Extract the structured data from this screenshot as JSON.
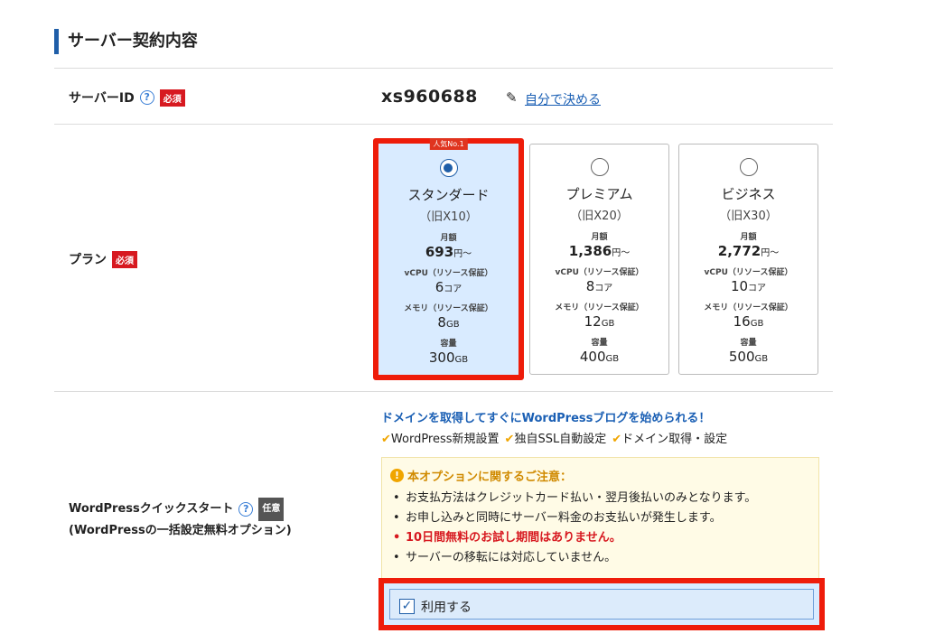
{
  "section": {
    "title": "サーバー契約内容"
  },
  "server_id_row": {
    "label": "サーバーID",
    "help": "?",
    "required": "必須",
    "value": "xs960688",
    "self_decide_link": "自分で決める"
  },
  "plan_row": {
    "label": "プラン",
    "required": "必須",
    "plans": [
      {
        "badge": "人気No.1",
        "name": "スタンダード",
        "old_name": "（旧X10）",
        "price_label": "月額",
        "price": "693",
        "price_unit": "円〜",
        "vcpu_label": "vCPU（リソース保証）",
        "vcpu": "6",
        "vcpu_unit": "コア",
        "mem_label": "メモリ（リソース保証）",
        "mem": "8",
        "mem_unit": "GB",
        "storage_label": "容量",
        "storage": "300",
        "storage_unit": "GB",
        "selected": true
      },
      {
        "name": "プレミアム",
        "old_name": "（旧X20）",
        "price_label": "月額",
        "price": "1,386",
        "price_unit": "円〜",
        "vcpu_label": "vCPU（リソース保証）",
        "vcpu": "8",
        "vcpu_unit": "コア",
        "mem_label": "メモリ（リソース保証）",
        "mem": "12",
        "mem_unit": "GB",
        "storage_label": "容量",
        "storage": "400",
        "storage_unit": "GB",
        "selected": false
      },
      {
        "name": "ビジネス",
        "old_name": "（旧X30）",
        "price_label": "月額",
        "price": "2,772",
        "price_unit": "円〜",
        "vcpu_label": "vCPU（リソース保証）",
        "vcpu": "10",
        "vcpu_unit": "コア",
        "mem_label": "メモリ（リソース保証）",
        "mem": "16",
        "mem_unit": "GB",
        "storage_label": "容量",
        "storage": "500",
        "storage_unit": "GB",
        "selected": false
      }
    ]
  },
  "wp_row": {
    "label_line1": "WordPressクイックスタート",
    "label_line2": "(WordPressの一括設定無料オプション)",
    "help": "?",
    "optional": "任意",
    "headline": "ドメインを取得してすぐにWordPressブログを始められる！",
    "features": [
      "WordPress新規設置",
      "独自SSL自動設定",
      "ドメイン取得・設定"
    ],
    "notice_title": "本オプションに関するご注意：",
    "notice_items": [
      "お支払方法はクレジットカード払い・翌月後払いのみとなります。",
      "お申し込みと同時にサーバー料金のお支払いが発生します。",
      "10日間無料のお試し期間はありません。",
      "サーバーの移転には対応していません。"
    ],
    "use_label": "利用する",
    "use_checked": true
  },
  "colors": {
    "accent": "#1f5ea8",
    "highlight": "#ee1c0a",
    "required": "#d71920",
    "warning": "#f0a500"
  }
}
